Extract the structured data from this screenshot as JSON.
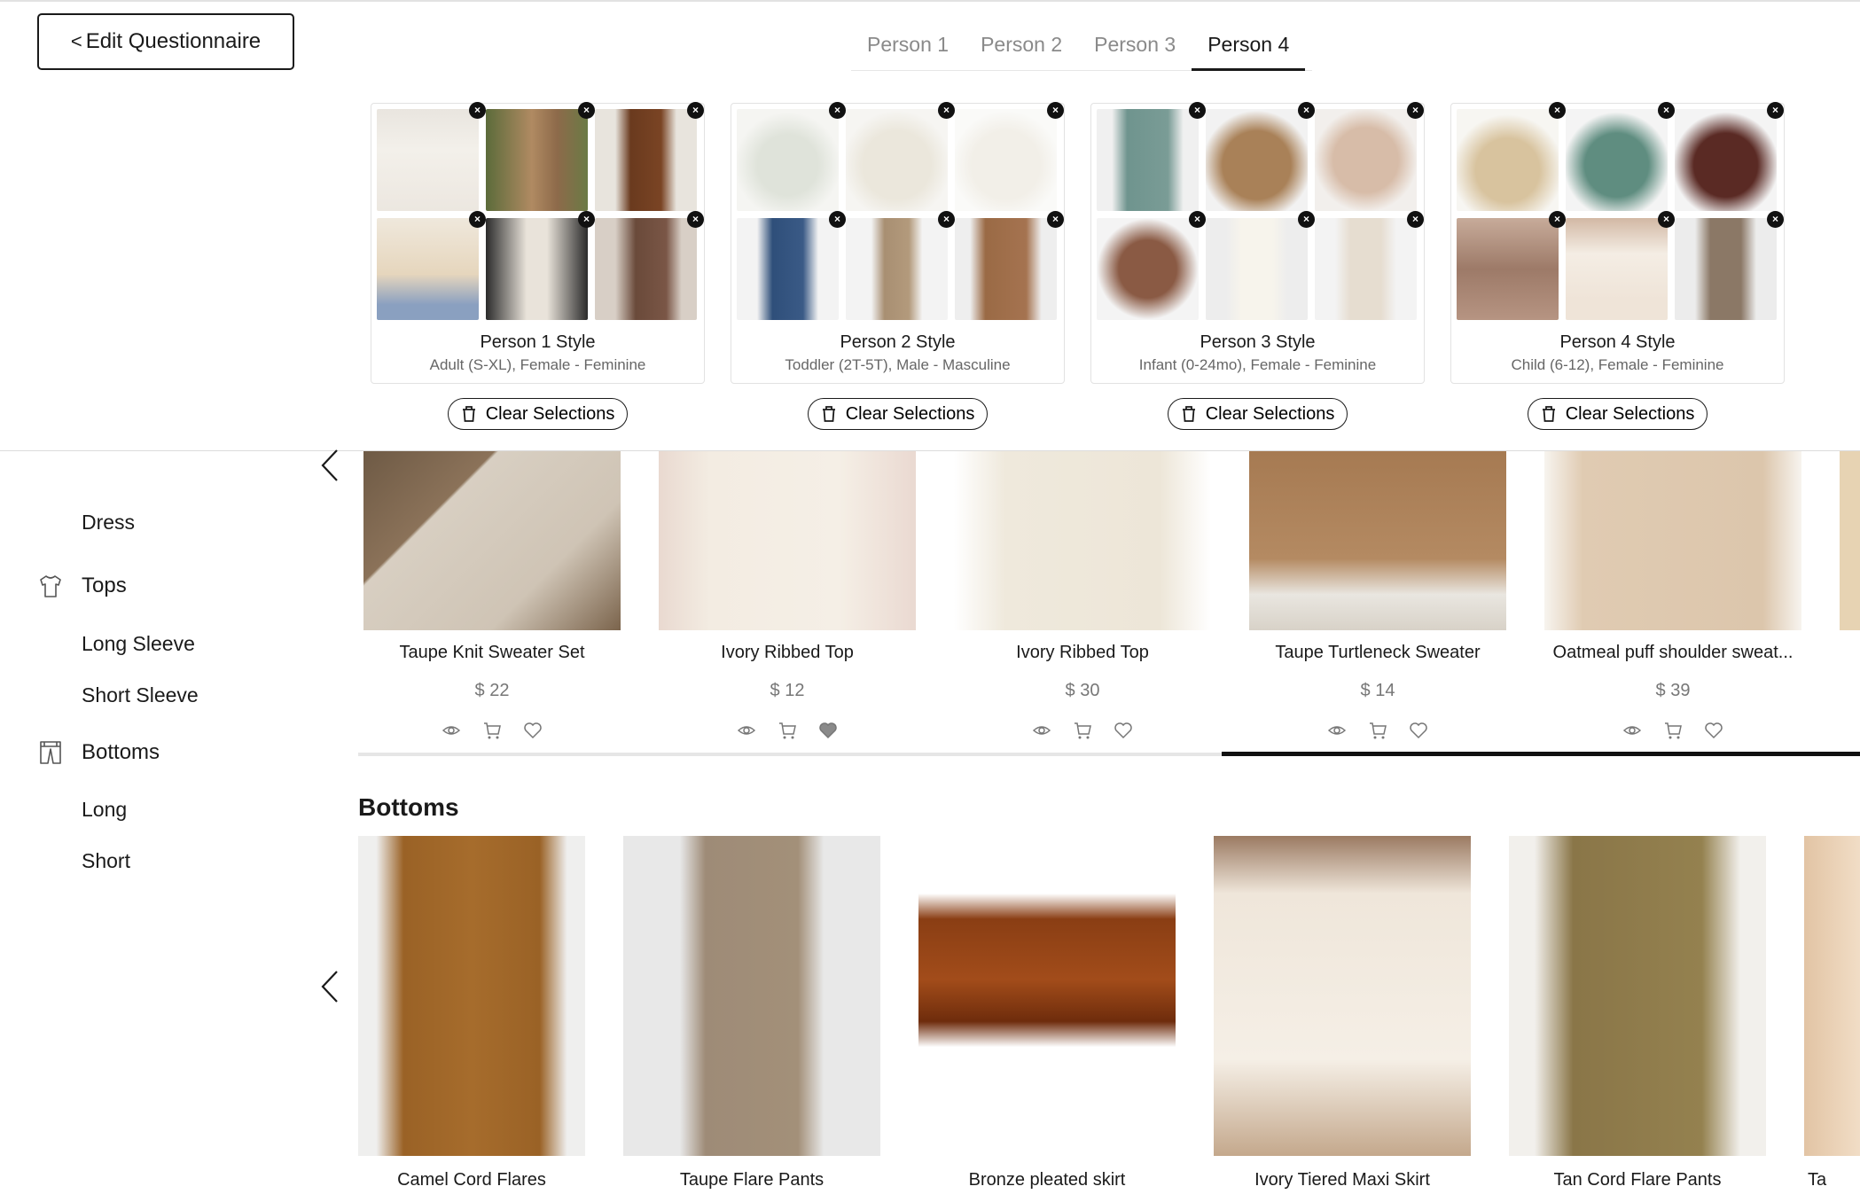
{
  "header": {
    "edit_button": "Edit Questionnaire",
    "tabs": [
      "Person 1",
      "Person 2",
      "Person 3",
      "Person 4"
    ],
    "active_tab": "Person 4"
  },
  "styles": [
    {
      "title": "Person 1 Style",
      "subtitle": "Adult (S-XL), Female - Feminine",
      "clear": "Clear Selections"
    },
    {
      "title": "Person 2 Style",
      "subtitle": "Toddler (2T-5T), Male - Masculine",
      "clear": "Clear Selections"
    },
    {
      "title": "Person 3 Style",
      "subtitle": "Infant (0-24mo), Female - Feminine",
      "clear": "Clear Selections"
    },
    {
      "title": "Person 4 Style",
      "subtitle": "Child (6-12), Female - Feminine",
      "clear": "Clear Selections"
    }
  ],
  "sidebar": {
    "dress": "Dress",
    "tops": "Tops",
    "tops_sub": [
      "Long Sleeve",
      "Short Sleeve"
    ],
    "bottoms": "Bottoms",
    "bottoms_sub": [
      "Long",
      "Short"
    ]
  },
  "tops": [
    {
      "name": "Taupe Knit Sweater Set",
      "price": "$ 22"
    },
    {
      "name": "Ivory Ribbed Top",
      "price": "$ 12"
    },
    {
      "name": "Ivory Ribbed Top",
      "price": "$ 30"
    },
    {
      "name": "Taupe Turtleneck Sweater",
      "price": "$ 14"
    },
    {
      "name": "Oatmeal puff shoulder sweat...",
      "price": "$ 39"
    }
  ],
  "bottoms": {
    "title": "Bottoms",
    "items": [
      "Camel Cord Flares",
      "Taupe Flare Pants",
      "Bronze pleated skirt",
      "Ivory Tiered Maxi Skirt",
      "Tan Cord Flare Pants",
      "Ta"
    ]
  },
  "colors": {
    "accent": "#111111",
    "muted_text": "#8a8a8a"
  }
}
